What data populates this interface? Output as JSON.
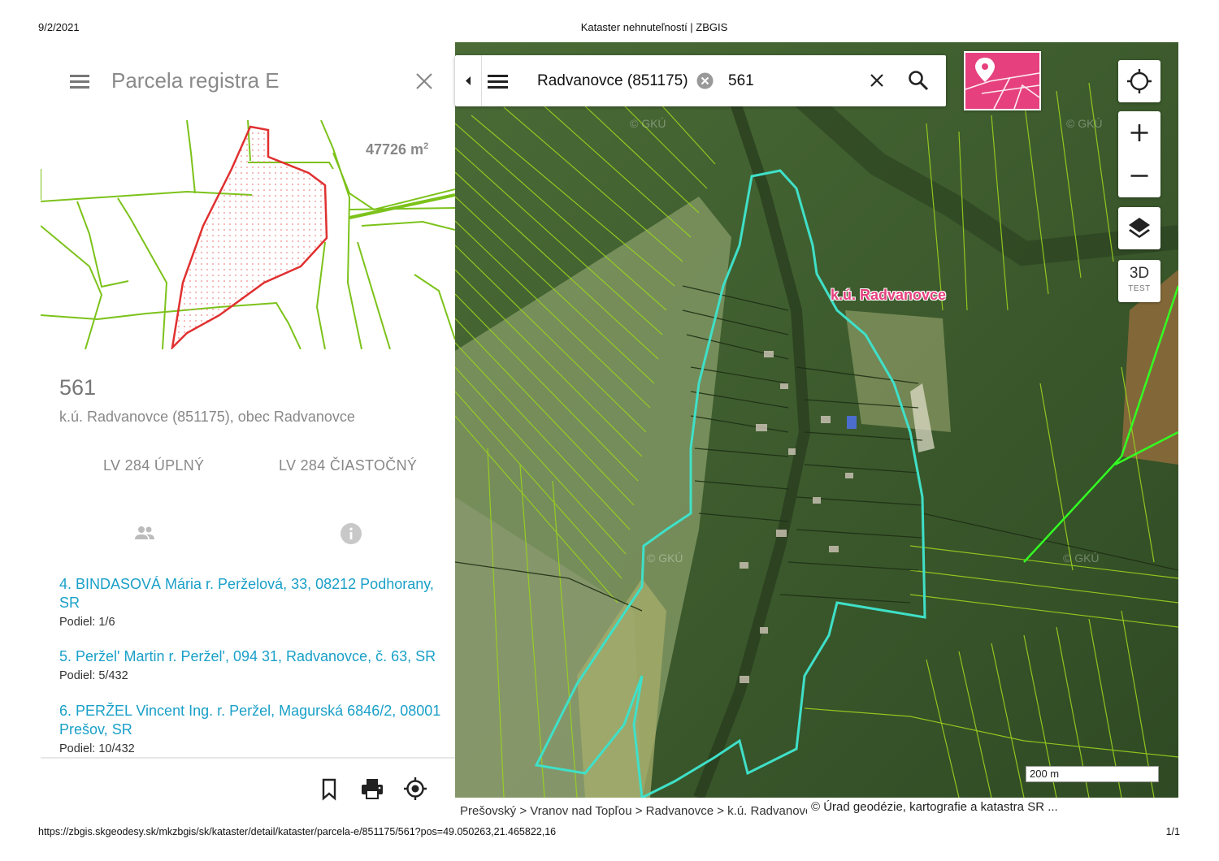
{
  "print": {
    "date": "9/2/2021",
    "title": "Kataster nehnuteľností | ZBGIS",
    "url": "https://zbgis.skgeodesy.sk/mkzbgis/sk/kataster/detail/kataster/parcela-e/851175/561?pos=49.050263,21.465822,16",
    "page": "1/1"
  },
  "panel": {
    "title": "Parcela registra E",
    "area_value": "47726 m",
    "area_unit_sup": "2",
    "parcel_number": "561",
    "location": "k.ú. Radvanovce (851175), obec Radvanovce",
    "lv_full": "LV 284 ÚPLNÝ",
    "lv_partial": "LV 284 ČIASTOČNÝ",
    "owners": [
      {
        "name": "4. BINDASOVÁ Mária r. Perželová, 33, 08212 Podhorany, SR",
        "share": "Podiel: 1/6"
      },
      {
        "name": "5. Peržel' Martin r. Peržel', 094 31, Radvanovce, č. 63, SR",
        "share": "Podiel: 5/432"
      },
      {
        "name": "6. PERŽEL Vincent Ing. r. Peržel, Magurská 6846/2, 08001 Prešov, SR",
        "share": "Podiel: 10/432"
      }
    ]
  },
  "map": {
    "search_chip": "Radvanovce (851175)",
    "search_query": "561",
    "label": "k.ú. Radvanovce",
    "btn_3d": "3D",
    "btn_3d_sub": "TEST",
    "scale": "200 m",
    "breadcrumb": "Prešovský > Vranov nad Topľou > Radvanovce > k.ú. Radvanovce",
    "attribution": "© Úrad geodézie, kartografie a katastra SR ...",
    "watermark": "© GKÚ"
  },
  "icons": {
    "menu": "menu-icon",
    "close": "close-icon",
    "owners": "people-icon",
    "info": "info-icon",
    "bookmark": "bookmark-icon",
    "print": "print-icon",
    "locate": "locate-icon",
    "search": "search-icon",
    "zoom_in": "plus-icon",
    "zoom_out": "minus-icon",
    "layers": "layers-icon"
  },
  "colors": {
    "accent_pink": "#e6417e",
    "link_blue": "#1aa0c8",
    "parcel_red": "#e03030",
    "boundary_cyan": "#2fd6c0",
    "parcel_lines_green": "#8ccc1a"
  }
}
